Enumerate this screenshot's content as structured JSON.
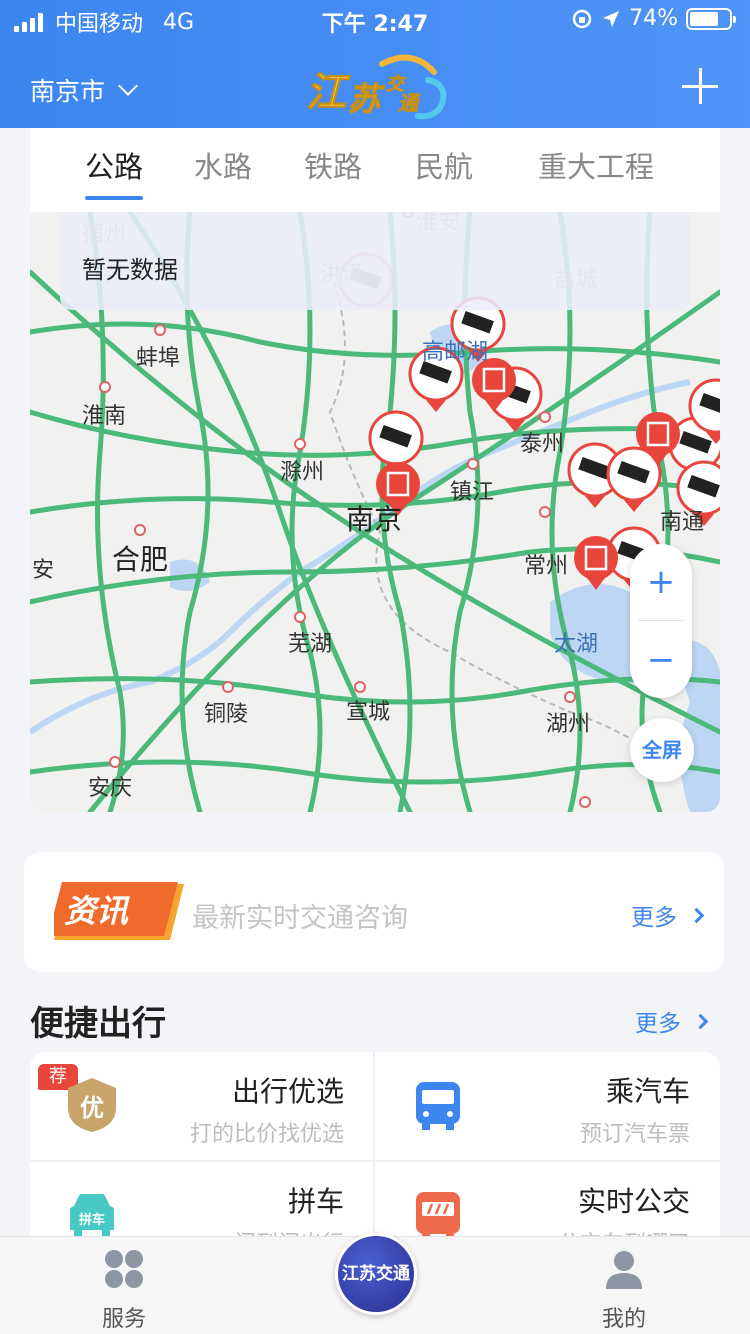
{
  "status_bar": {
    "carrier": "中国移动",
    "network": "4G",
    "time": "下午 2:47",
    "battery": "74%",
    "battery_level": 0.74
  },
  "header": {
    "city": "南京市",
    "logo_text": "江苏交通"
  },
  "tabs": [
    "公路",
    "水路",
    "铁路",
    "民航",
    "重大工程"
  ],
  "active_tab": 0,
  "map": {
    "notice": "暂无数据",
    "labels": [
      "宿州",
      "淮安",
      "洪泽",
      "盐城",
      "高邮湖",
      "蚌埠",
      "淮南",
      "泰州",
      "滁州",
      "镇江",
      "南京",
      "合肥",
      "安",
      "常州",
      "南通",
      "芜湖",
      "太湖",
      "铜陵",
      "宣城",
      "湖州",
      "安庆"
    ],
    "zoom_in": "+",
    "zoom_out": "−",
    "fullscreen": "全屏"
  },
  "news": {
    "badge": "资讯",
    "text": "最新实时交通咨询",
    "more": "更多"
  },
  "quick_travel": {
    "title": "便捷出行",
    "more": "更多",
    "recommend_tag": "荐",
    "items": [
      {
        "title": "出行优选",
        "subtitle": "打的比价找优选",
        "icon": "badge-you-icon",
        "icon_text": "优"
      },
      {
        "title": "乘汽车",
        "subtitle": "预订汽车票",
        "icon": "bus-icon"
      },
      {
        "title": "拼车",
        "subtitle": "门到门出行",
        "icon": "carpool-icon",
        "icon_text": "拼车"
      },
      {
        "title": "实时公交",
        "subtitle": "公交车到哪了",
        "icon": "realtime-bus-icon"
      }
    ]
  },
  "bottom_nav": {
    "service": "服务",
    "center": "江苏交通",
    "mine": "我的"
  },
  "colors": {
    "primary": "#3d86f0",
    "road": "#4bb97a",
    "marker": "#e8453c"
  }
}
